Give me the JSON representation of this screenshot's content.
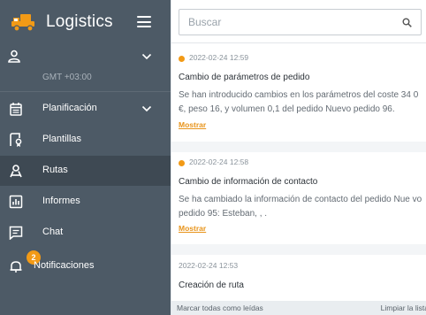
{
  "app": {
    "title": "Logistics",
    "logo_icon": "truck-icon",
    "menu_icon": "hamburger-icon",
    "colors": {
      "sidebar_bg": "#4d5a66",
      "sidebar_active": "#3e4953",
      "accent": "#f29a16"
    }
  },
  "user": {
    "icon": "user-icon",
    "timezone": "GMT +03:00"
  },
  "sidebar": {
    "items": [
      {
        "label": "Planificación",
        "icon": "calendar-icon",
        "has_chevron": true
      },
      {
        "label": "Plantillas",
        "icon": "template-icon"
      },
      {
        "label": "Rutas",
        "icon": "route-icon",
        "active": true
      },
      {
        "label": "Informes",
        "icon": "report-icon"
      },
      {
        "label": "Chat",
        "icon": "chat-icon"
      },
      {
        "label": "Notificaciones",
        "icon": "bell-icon",
        "badge": "2"
      }
    ]
  },
  "search": {
    "placeholder": "Buscar",
    "icon": "search-icon"
  },
  "notifications": [
    {
      "unread": true,
      "time": "2022-02-24 12:59",
      "title": "Cambio de parámetros de pedido",
      "body": "Se han introducido cambios en los parámetros del coste 34 0 €, peso 16, y volumen 0,1 del pedido Nuevo pedido 96.",
      "more": "Mostrar"
    },
    {
      "unread": true,
      "time": "2022-02-24 12:58",
      "title": "Cambio de información de contacto",
      "body": "Se ha cambiado la información de contacto del pedido Nue vo pedido 95: Esteban, , .",
      "more": "Mostrar"
    },
    {
      "unread": false,
      "time": "2022-02-24 12:53",
      "title": "Creación de ruta"
    }
  ],
  "footer": {
    "mark_all_read": "Marcar todas como leídas",
    "clear_list": "Limpiar la lista"
  }
}
